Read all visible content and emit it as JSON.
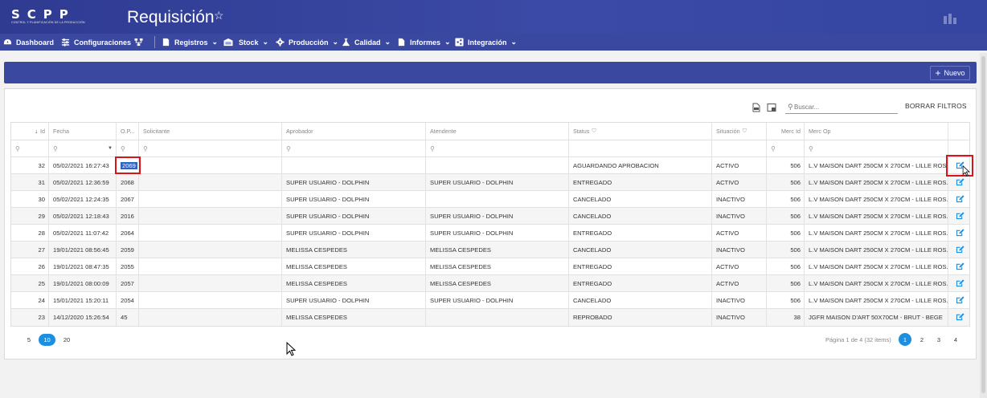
{
  "app": {
    "logo_text": "SCPP",
    "logo_subtitle": "CONTROL Y PLANIFICACIÓN DE LA PRODUCCIÓN",
    "page_title": "Requisición"
  },
  "nav": {
    "dashboard": "Dashboard",
    "configuraciones": "Configuraciones",
    "registros": "Registros",
    "stock": "Stock",
    "produccion": "Producción",
    "calidad": "Calidad",
    "informes": "Informes",
    "integracion": "Integración"
  },
  "toolbar": {
    "nuevo_label": "Nuevo",
    "search_placeholder": "Buscar...",
    "clear_filters_label": "BORRAR FILTROS"
  },
  "columns": {
    "id": "Id",
    "fecha": "Fecha",
    "op": "O.P...",
    "solicitante": "Solicitante",
    "aprobador": "Aprobador",
    "atendente": "Atendente",
    "status": "Status",
    "situacion": "Situación",
    "merc_id": "Merc Id",
    "merc_op": "Merc Op"
  },
  "rows": [
    {
      "id": "32",
      "fecha": "05/02/2021 16:27:43",
      "op": "2069",
      "solicitante": "",
      "aprobador": "",
      "atendente": "",
      "status": "AGUARDANDO APROBACION",
      "situacion": "ACTIVO",
      "merc_id": "506",
      "merc_op": "L.V MAISON DART 250CM X 270CM - LILLE ROS..."
    },
    {
      "id": "31",
      "fecha": "05/02/2021 12:36:59",
      "op": "2068",
      "solicitante": "",
      "aprobador": "SUPER USUARIO - DOLPHIN",
      "atendente": "SUPER USUARIO - DOLPHIN",
      "status": "ENTREGADO",
      "situacion": "ACTIVO",
      "merc_id": "506",
      "merc_op": "L.V MAISON DART 250CM X 270CM - LILLE ROS..."
    },
    {
      "id": "30",
      "fecha": "05/02/2021 12:24:35",
      "op": "2067",
      "solicitante": "",
      "aprobador": "SUPER USUARIO - DOLPHIN",
      "atendente": "",
      "status": "CANCELADO",
      "situacion": "INACTIVO",
      "merc_id": "506",
      "merc_op": "L.V MAISON DART 250CM X 270CM - LILLE ROS..."
    },
    {
      "id": "29",
      "fecha": "05/02/2021 12:18:43",
      "op": "2016",
      "solicitante": "",
      "aprobador": "SUPER USUARIO - DOLPHIN",
      "atendente": "SUPER USUARIO - DOLPHIN",
      "status": "CANCELADO",
      "situacion": "INACTIVO",
      "merc_id": "506",
      "merc_op": "L.V MAISON DART 250CM X 270CM - LILLE ROS..."
    },
    {
      "id": "28",
      "fecha": "05/02/2021 11:07:42",
      "op": "2064",
      "solicitante": "",
      "aprobador": "SUPER USUARIO - DOLPHIN",
      "atendente": "SUPER USUARIO - DOLPHIN",
      "status": "ENTREGADO",
      "situacion": "ACTIVO",
      "merc_id": "506",
      "merc_op": "L.V MAISON DART 250CM X 270CM - LILLE ROS..."
    },
    {
      "id": "27",
      "fecha": "19/01/2021 08:56:45",
      "op": "2059",
      "solicitante": "",
      "aprobador": "MELISSA CESPEDES",
      "atendente": "MELISSA CESPEDES",
      "status": "CANCELADO",
      "situacion": "INACTIVO",
      "merc_id": "506",
      "merc_op": "L.V MAISON DART 250CM X 270CM - LILLE ROS..."
    },
    {
      "id": "26",
      "fecha": "19/01/2021 08:47:35",
      "op": "2055",
      "solicitante": "",
      "aprobador": "MELISSA CESPEDES",
      "atendente": "MELISSA CESPEDES",
      "status": "ENTREGADO",
      "situacion": "ACTIVO",
      "merc_id": "506",
      "merc_op": "L.V MAISON DART 250CM X 270CM - LILLE ROS..."
    },
    {
      "id": "25",
      "fecha": "19/01/2021 08:00:09",
      "op": "2057",
      "solicitante": "",
      "aprobador": "MELISSA CESPEDES",
      "atendente": "MELISSA CESPEDES",
      "status": "ENTREGADO",
      "situacion": "ACTIVO",
      "merc_id": "506",
      "merc_op": "L.V MAISON DART 250CM X 270CM - LILLE ROS..."
    },
    {
      "id": "24",
      "fecha": "15/01/2021 15:20:11",
      "op": "2054",
      "solicitante": "",
      "aprobador": "SUPER USUARIO - DOLPHIN",
      "atendente": "SUPER USUARIO - DOLPHIN",
      "status": "CANCELADO",
      "situacion": "INACTIVO",
      "merc_id": "506",
      "merc_op": "L.V MAISON DART 250CM X 270CM - LILLE ROS..."
    },
    {
      "id": "23",
      "fecha": "14/12/2020 15:26:54",
      "op": "45",
      "solicitante": "",
      "aprobador": "MELISSA CESPEDES",
      "atendente": "",
      "status": "REPROBADO",
      "situacion": "INACTIVO",
      "merc_id": "38",
      "merc_op": "JGFR MAISON D'ART 50X70CM - BRUT - BEGE"
    }
  ],
  "pager": {
    "sizes": [
      "5",
      "10",
      "20"
    ],
    "active_size": "10",
    "info": "Página 1 de 4 (32 items)",
    "pages": [
      "1",
      "2",
      "3",
      "4"
    ],
    "active_page": "1"
  },
  "colors": {
    "header": "#3a48a0",
    "accent": "#1e8fe0",
    "highlight": "#d9141b"
  }
}
